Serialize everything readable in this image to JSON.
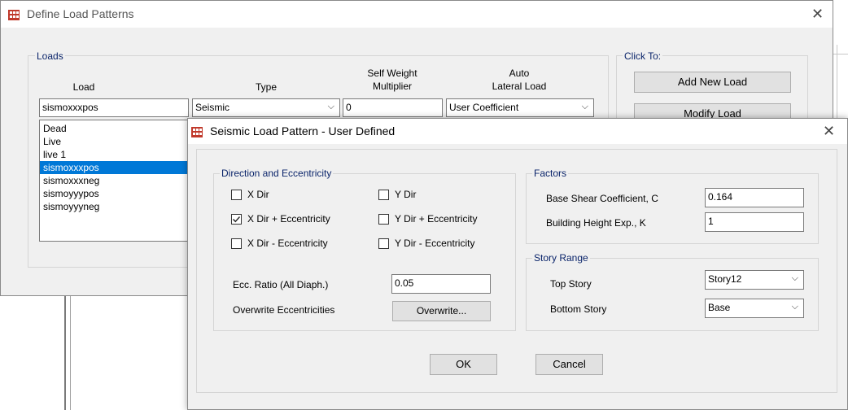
{
  "main_dialog": {
    "title": "Define Load Patterns",
    "loads_group_label": "Loads",
    "headers": {
      "load": "Load",
      "type": "Type",
      "self_weight_line1": "Self Weight",
      "self_weight_line2": "Multiplier",
      "auto_line1": "Auto",
      "auto_line2": "Lateral Load"
    },
    "load_name_value": "sismoxxxpos",
    "type_value": "Seismic",
    "multiplier_value": "0",
    "auto_lateral_value": "User Coefficient",
    "load_list": [
      "Dead",
      "Live",
      "live 1",
      "sismoxxxpos",
      "sismoxxxneg",
      "sismoyyypos",
      "sismoyyyneg"
    ],
    "selected_index": 3,
    "click_to_label": "Click To:",
    "add_new_load": "Add New Load",
    "modify_load": "Modify Load"
  },
  "sub_dialog": {
    "title": "Seismic Load Pattern - User Defined",
    "direction_group_label": "Direction and Eccentricity",
    "checkboxes": {
      "x_dir": {
        "label": "X Dir",
        "checked": false
      },
      "y_dir": {
        "label": "Y Dir",
        "checked": false
      },
      "x_dir_plus": {
        "label": "X Dir + Eccentricity",
        "checked": true
      },
      "y_dir_plus": {
        "label": "Y Dir + Eccentricity",
        "checked": false
      },
      "x_dir_minus": {
        "label": "X Dir - Eccentricity",
        "checked": false
      },
      "y_dir_minus": {
        "label": "Y Dir - Eccentricity",
        "checked": false
      }
    },
    "ecc_ratio_label": "Ecc. Ratio (All Diaph.)",
    "ecc_ratio_value": "0.05",
    "overwrite_label": "Overwrite Eccentricities",
    "overwrite_button": "Overwrite...",
    "factors_group_label": "Factors",
    "base_shear_label": "Base Shear Coefficient, C",
    "base_shear_value": "0.164",
    "height_exp_label": "Building Height Exp., K",
    "height_exp_value": "1",
    "story_range_label": "Story Range",
    "top_story_label": "Top Story",
    "top_story_value": "Story12",
    "bottom_story_label": "Bottom Story",
    "bottom_story_value": "Base",
    "ok_button": "OK",
    "cancel_button": "Cancel"
  },
  "icons": {
    "app": "etabs-app-icon",
    "close": "close-icon",
    "dropdown": "chevron-down-icon",
    "check": "checkmark-icon"
  },
  "colors": {
    "accent": "#0078d7",
    "group_label": "#0a246a",
    "dialog_bg": "#f0f0f0"
  }
}
